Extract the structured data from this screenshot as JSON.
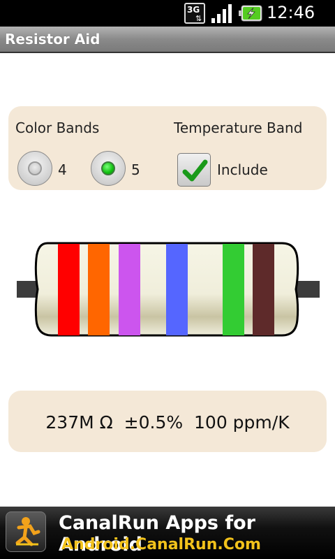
{
  "status_bar": {
    "network_label": "3G",
    "time": "12:46"
  },
  "app": {
    "title": "Resistor Aid"
  },
  "options": {
    "color_bands_label": "Color Bands",
    "temperature_band_label": "Temperature Band",
    "band_options": [
      {
        "label": "4",
        "checked": false
      },
      {
        "label": "5",
        "checked": true
      }
    ],
    "include_label": "Include",
    "include_checked": true
  },
  "resistor": {
    "body_color": "#f3f1dc",
    "band_colors": [
      "#ff0000",
      "#ff6600",
      "#cc55ee",
      "#5566ff",
      "#33cc33",
      "#5e2a2a"
    ],
    "band_names": [
      "red",
      "orange",
      "violet",
      "blue",
      "green",
      "brown"
    ]
  },
  "result": {
    "resistance": "237M Ω",
    "tolerance": "±0.5%",
    "temp_coefficient": "100 ppm/K"
  },
  "ad": {
    "title": "CanalRun Apps for Android",
    "url": "Android.CanalRun.Com",
    "accent_color": "#f2c21b"
  }
}
